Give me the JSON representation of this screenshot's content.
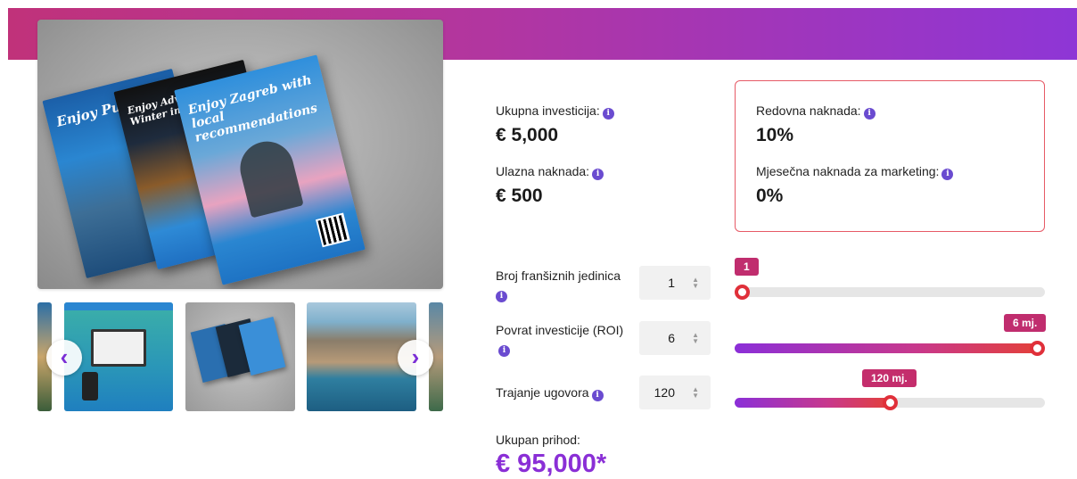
{
  "banner": {
    "colors": [
      "#c0327a",
      "#8e36d6"
    ]
  },
  "gallery": {
    "hero_flyers": [
      "Enjoy Pula",
      "Enjoy Advent and Winter in Zagreb",
      "Enjoy Zagreb with local recommendations"
    ],
    "thumbnails": [
      "brochure-partial",
      "desktop-and-phone-promo",
      "flyers-stack",
      "coastal-town-aerial",
      "coast-partial"
    ],
    "prev_icon": "chevron-left-icon",
    "next_icon": "chevron-right-icon"
  },
  "investment": {
    "total_label": "Ukupna investicija:",
    "total_value": "€ 5,000",
    "entry_label": "Ulazna naknada:",
    "entry_value": "€ 500"
  },
  "fees": {
    "regular_label": "Redovna naknada:",
    "regular_value": "10%",
    "marketing_label": "Mjesečna naknada za marketing:",
    "marketing_value": "0%"
  },
  "calculator": {
    "units": {
      "label": "Broj franšiznih jedinica",
      "value": "1",
      "tooltip": "1",
      "level": 0.0
    },
    "roi": {
      "label": "Povrat investicije (ROI)",
      "value": "6",
      "tooltip": "6 mj.",
      "level": 1.0
    },
    "duration": {
      "label": "Trajanje ugovora",
      "value": "120",
      "tooltip": "120 mj.",
      "level": 0.5
    }
  },
  "revenue": {
    "label": "Ukupan prihod:",
    "value": "€ 95,000*"
  },
  "colors": {
    "accent_purple": "#8a2fd6",
    "accent_red": "#e0303a",
    "info_icon": "#6a4bd0"
  }
}
